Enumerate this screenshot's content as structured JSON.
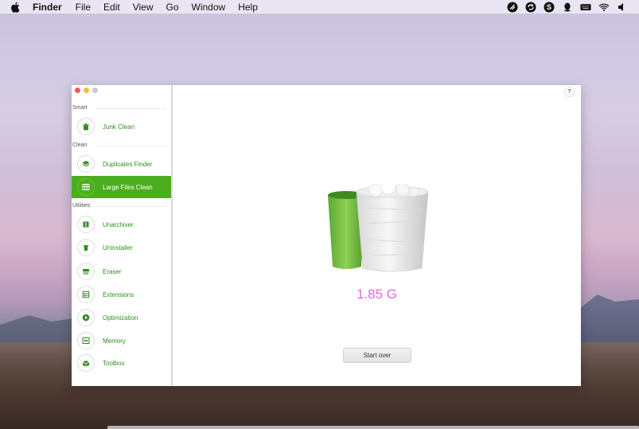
{
  "menubar": {
    "app_name": "Finder",
    "items": [
      "File",
      "Edit",
      "View",
      "Go",
      "Window",
      "Help"
    ],
    "status_icons": [
      "cleaner-app-icon",
      "sync-icon",
      "skype-icon",
      "qq-icon",
      "keyboard-icon",
      "wifi-icon",
      "volume-icon"
    ]
  },
  "window": {
    "help_label": "?",
    "traffic_colors": {
      "close": "#ee5b52",
      "minimize": "#f3b93f",
      "zoom": "#c9c9c9"
    }
  },
  "sidebar": {
    "sections": {
      "smart": "Smart",
      "clean": "Clean",
      "utilities": "Utilities"
    },
    "items": [
      {
        "label": "Junk Clean",
        "icon": "trash-bin-icon",
        "active": false
      },
      {
        "label": "Duplicates Finder",
        "icon": "layers-icon",
        "active": false
      },
      {
        "label": "Large Files Clean",
        "icon": "large-files-icon",
        "active": true
      },
      {
        "label": "Unarchiver",
        "icon": "archive-icon",
        "active": false
      },
      {
        "label": "Uninstaller",
        "icon": "uninstall-icon",
        "active": false
      },
      {
        "label": "Eraser",
        "icon": "shredder-icon",
        "active": false
      },
      {
        "label": "Extensions",
        "icon": "extensions-icon",
        "active": false
      },
      {
        "label": "Optimization",
        "icon": "play-icon",
        "active": false
      },
      {
        "label": "Memory",
        "icon": "memory-icon",
        "active": false
      },
      {
        "label": "Toolbox",
        "icon": "toolbox-icon",
        "active": false
      }
    ]
  },
  "main": {
    "size_value": "1.85 G",
    "start_over_label": "Start over"
  },
  "colors": {
    "accent_green": "#4cae1f",
    "label_green": "#2f8f1f",
    "size_pink": "#e06ae0"
  }
}
